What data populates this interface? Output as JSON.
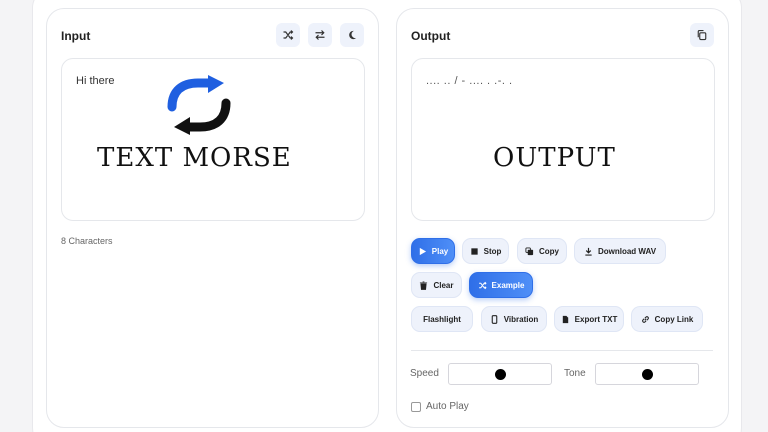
{
  "input": {
    "title": "Input",
    "text": "Hi there",
    "char_count": "8 Characters",
    "overlay_label": "TEXT  MORSE",
    "header_icons": [
      "shuffle-icon",
      "swap-icon",
      "moon-icon"
    ]
  },
  "output": {
    "title": "Output",
    "morse": ".... .. / - .... . .-. .",
    "overlay_label": "OUTPUT",
    "header_icon": "copy-icon",
    "buttons": {
      "play": "Play",
      "stop": "Stop",
      "copy": "Copy",
      "download": "Download WAV",
      "clear": "Clear",
      "example": "Example",
      "flashlight": "Flashlight",
      "vibration": "Vibration",
      "export": "Export TXT",
      "copy_link": "Copy Link"
    },
    "speed_label": "Speed",
    "speed_level": 0.5,
    "tone_label": "Tone",
    "tone_level": 0.5,
    "auto_play_label": "Auto Play",
    "auto_play_checked": false
  },
  "colors": {
    "accent": "#2f6fe8",
    "icon_blue": "#1f5fe0",
    "icon_black": "#111111"
  }
}
